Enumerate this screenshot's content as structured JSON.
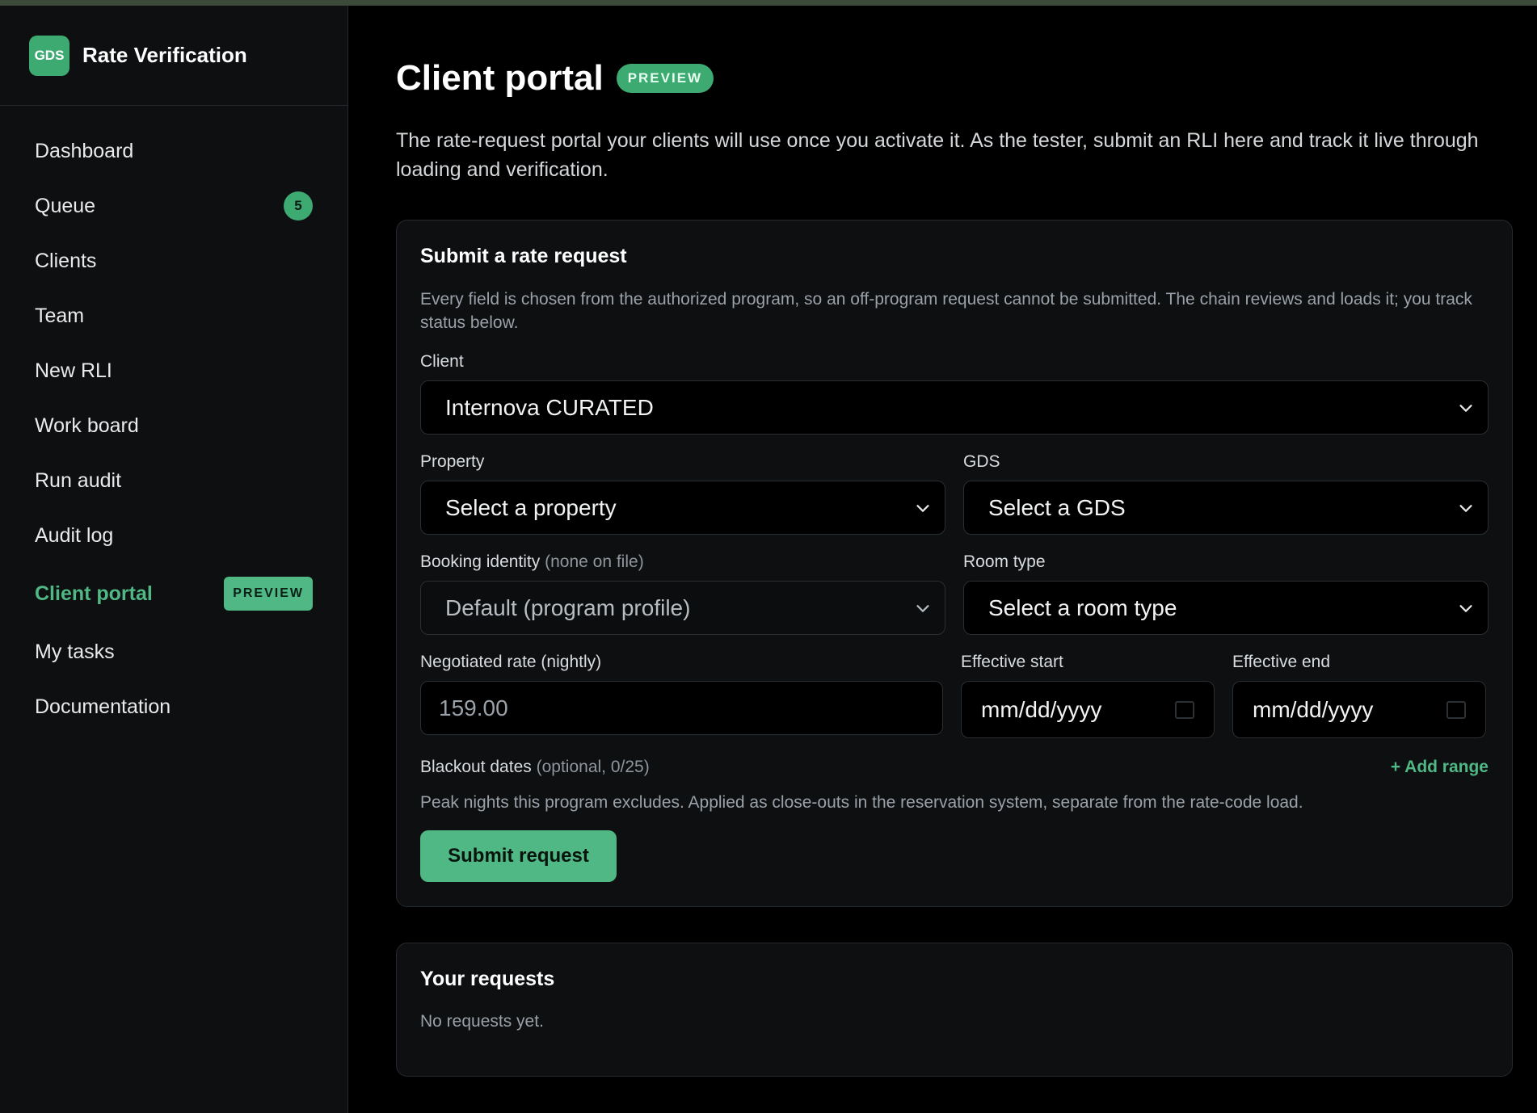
{
  "brand": {
    "logo": "GDS",
    "name": "Rate Verification"
  },
  "nav": [
    {
      "label": "Dashboard"
    },
    {
      "label": "Queue",
      "badge": "5"
    },
    {
      "label": "Clients"
    },
    {
      "label": "Team"
    },
    {
      "label": "New RLI"
    },
    {
      "label": "Work board"
    },
    {
      "label": "Run audit"
    },
    {
      "label": "Audit log"
    },
    {
      "label": "Client portal",
      "pill": "PREVIEW",
      "active": true
    },
    {
      "label": "My tasks"
    },
    {
      "label": "Documentation"
    }
  ],
  "page": {
    "title": "Client portal",
    "pill": "PREVIEW",
    "intro": "The rate-request portal your clients will use once you activate it. As the tester, submit an RLI here and track it live through loading and verification."
  },
  "form": {
    "title": "Submit a rate request",
    "description": "Every field is chosen from the authorized program, so an off-program request cannot be submitted. The chain reviews and loads it; you track status below.",
    "client": {
      "label": "Client",
      "value": "Internova CURATED"
    },
    "property": {
      "label": "Property",
      "value": "Select a property"
    },
    "gds": {
      "label": "GDS",
      "value": "Select a GDS"
    },
    "booking_identity": {
      "label": "Booking identity",
      "note": "(none on file)",
      "value": "Default (program profile)"
    },
    "room_type": {
      "label": "Room type",
      "value": "Select a room type"
    },
    "rate": {
      "label": "Negotiated rate (nightly)",
      "placeholder": "159.00"
    },
    "effective_start": {
      "label": "Effective start",
      "placeholder": "mm/dd/yyyy"
    },
    "effective_end": {
      "label": "Effective end",
      "placeholder": "mm/dd/yyyy"
    },
    "blackout": {
      "label": "Blackout dates",
      "note": "(optional, 0/25)",
      "add_label": "+ Add range",
      "description": "Peak nights this program excludes. Applied as close-outs in the reservation system, separate from the rate-code load."
    },
    "submit_label": "Submit request"
  },
  "requests": {
    "title": "Your requests",
    "empty": "No requests yet."
  },
  "colors": {
    "accent": "#4fb884",
    "background": "#000000",
    "sidebar": "#0d0f11"
  }
}
